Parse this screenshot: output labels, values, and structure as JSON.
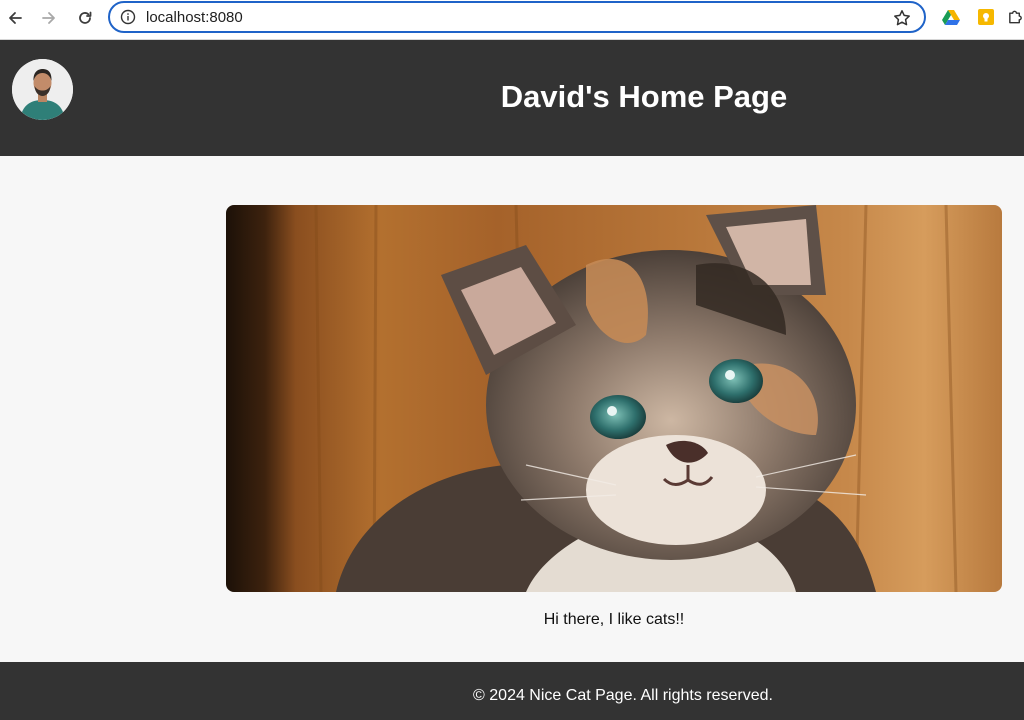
{
  "browser": {
    "url": "localhost:8080",
    "icons": {
      "back": "arrow-left-icon",
      "forward": "arrow-right-icon",
      "reload": "reload-icon",
      "info": "info-icon",
      "bookmark": "star-icon",
      "extension_drive": "google-drive-icon",
      "extension_keep": "google-keep-icon",
      "extensions": "puzzle-icon"
    },
    "colors": {
      "focus_ring": "#1f63c8"
    }
  },
  "header": {
    "title": "David's Home Page",
    "background": "#333333"
  },
  "main": {
    "caption": "Hi there, I like cats!!"
  },
  "footer": {
    "text": "© 2024 Nice Cat Page. All rights reserved.",
    "background": "#333333"
  }
}
